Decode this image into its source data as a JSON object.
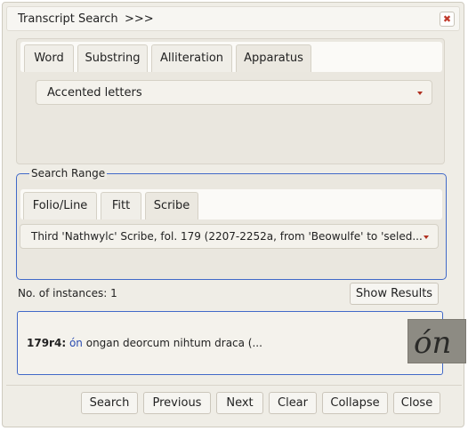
{
  "window": {
    "title": "Transcript Search",
    "title_suffix": ">>>",
    "close_glyph": "✖"
  },
  "search_tabs": [
    {
      "label": "Word",
      "active": false
    },
    {
      "label": "Substring",
      "active": false
    },
    {
      "label": "Alliteration",
      "active": false
    },
    {
      "label": "Apparatus",
      "active": true
    }
  ],
  "apparatus": {
    "selected": "Accented letters"
  },
  "search_range": {
    "legend": "Search Range",
    "tabs": [
      {
        "label": "Folio/Line",
        "active": false
      },
      {
        "label": "Fitt",
        "active": false
      },
      {
        "label": "Scribe",
        "active": true
      }
    ],
    "scribe_selected": "Third 'Nathwylc' Scribe, fol. 179 (2207-2252a, from 'Beowulfe' to 'seled..."
  },
  "instances": {
    "label": "No. of instances: 1"
  },
  "show_results_label": "Show Results",
  "result": {
    "ref": "179r4:",
    "highlight": "ón",
    "rest": " ongan deorcum nihtum draca (..."
  },
  "thumbnail": {
    "glyph": "ón"
  },
  "footer_buttons": {
    "search": "Search",
    "previous": "Previous",
    "next": "Next",
    "clear": "Clear",
    "collapse": "Collapse",
    "close": "Close"
  },
  "colors": {
    "accent_border": "#4169c8",
    "caret": "#b03020",
    "close_x": "#c0392b",
    "highlight": "#2a4cb0"
  }
}
